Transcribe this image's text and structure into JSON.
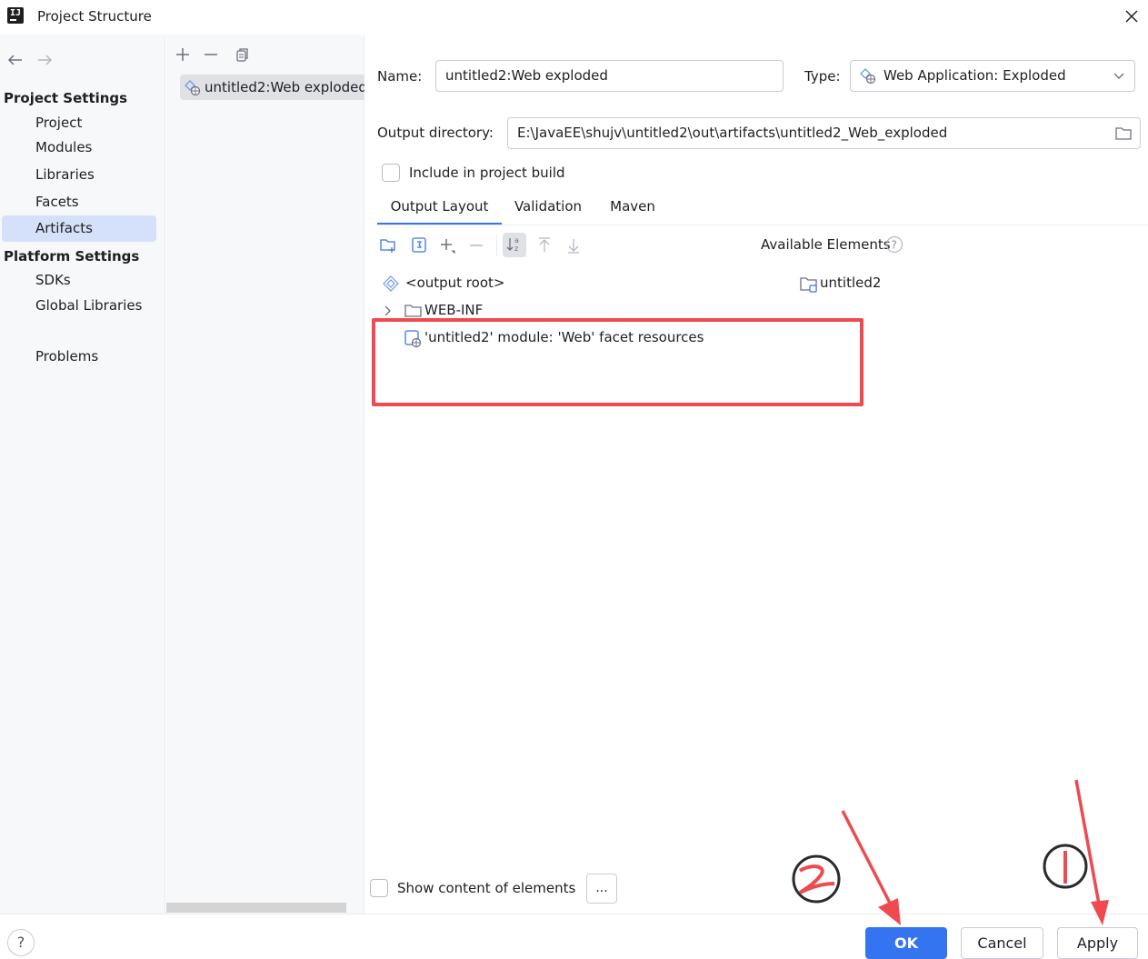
{
  "window": {
    "title": "Project Structure"
  },
  "sidebar": {
    "project_settings_header": "Project Settings",
    "platform_settings_header": "Platform Settings",
    "items": [
      {
        "label": "Project"
      },
      {
        "label": "Modules"
      },
      {
        "label": "Libraries"
      },
      {
        "label": "Facets"
      },
      {
        "label": "Artifacts",
        "selected": true
      },
      {
        "label": "SDKs"
      },
      {
        "label": "Global Libraries"
      },
      {
        "label": "Problems"
      }
    ]
  },
  "artifacts_list": {
    "items": [
      {
        "label": "untitled2:Web exploded",
        "selected": true
      }
    ]
  },
  "form": {
    "name_label": "Name:",
    "name_value": "untitled2:Web exploded",
    "type_label": "Type:",
    "type_value": "Web Application: Exploded",
    "output_dir_label": "Output directory:",
    "output_dir_value": "E:\\JavaEE\\shujv\\untitled2\\out\\artifacts\\untitled2_Web_exploded",
    "include_build_label": "Include in project build",
    "include_build_checked": false
  },
  "tabs": [
    {
      "label": "Output Layout",
      "active": true
    },
    {
      "label": "Validation"
    },
    {
      "label": "Maven"
    }
  ],
  "layout": {
    "available_elements_label": "Available Elements",
    "tree": [
      {
        "label": "<output root>"
      },
      {
        "label": "WEB-INF"
      },
      {
        "label": "'untitled2' module: 'Web' facet resources"
      }
    ],
    "available": [
      {
        "label": "untitled2"
      }
    ],
    "show_content_label": "Show content of elements",
    "dots_label": "..."
  },
  "buttons": {
    "ok": "OK",
    "cancel": "Cancel",
    "apply": "Apply",
    "help": "?"
  },
  "colors": {
    "accent": "#3574f0",
    "annotation": "#ef4a4f",
    "selection": "#d5e1fb"
  }
}
